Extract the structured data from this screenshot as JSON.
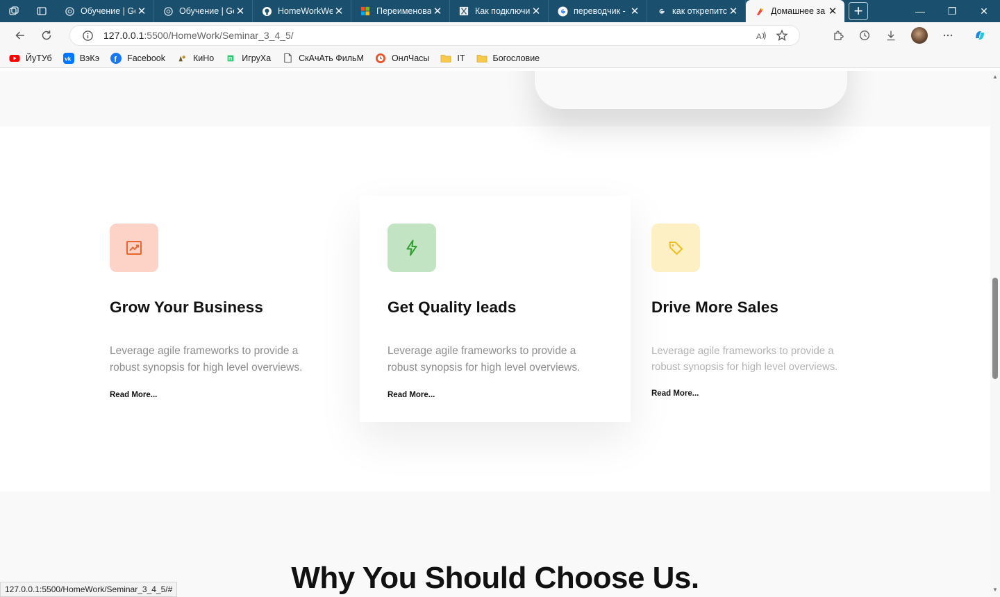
{
  "browser": {
    "tabs": [
      {
        "title": "Обучение | Ge",
        "favicon": "gear-favicon"
      },
      {
        "title": "Обучение | Ge",
        "favicon": "gear-favicon"
      },
      {
        "title": "HomeWorkWe",
        "favicon": "github-favicon"
      },
      {
        "title": "Переименова",
        "favicon": "microsoft-favicon"
      },
      {
        "title": "Как подключи",
        "favicon": "x-favicon"
      },
      {
        "title": "переводчик -",
        "favicon": "google-favicon"
      },
      {
        "title": "как открепитс",
        "favicon": "google-gray-favicon"
      },
      {
        "title": "Домашнее за",
        "favicon": "liveserver-favicon"
      }
    ],
    "address": {
      "host": "127.0.0.1",
      "path": ":5500/HomeWork/Seminar_3_4_5/"
    },
    "favorites": [
      {
        "label": "ЙуТУб",
        "icon": "youtube-icon"
      },
      {
        "label": "ВэКэ",
        "icon": "vk-icon"
      },
      {
        "label": "Facebook",
        "icon": "facebook-icon"
      },
      {
        "label": "КиНо",
        "icon": "kino-icon"
      },
      {
        "label": "ИгруХа",
        "icon": "game-icon"
      },
      {
        "label": "СкАчАть ФильМ",
        "icon": "page-icon"
      },
      {
        "label": "ОнлЧасы",
        "icon": "clock-icon"
      },
      {
        "label": "IT",
        "icon": "folder-icon"
      },
      {
        "label": "Богословие",
        "icon": "folder-icon"
      }
    ],
    "status_url": "127.0.0.1:5500/HomeWork/Seminar_3_4_5/#"
  },
  "page": {
    "cards": [
      {
        "title": "Grow Your Business",
        "text": "Leverage agile frameworks to provide a robust synopsis for high level overviews.",
        "link": "Read More...",
        "icon": "chart-up-icon",
        "icon_bg": "#fcd3c6",
        "icon_color": "#e8652f"
      },
      {
        "title": "Get Quality leads",
        "text": "Leverage agile frameworks to provide a robust synopsis for high level overviews.",
        "link": "Read More...",
        "icon": "lightning-icon",
        "icon_bg": "#c3e4c2",
        "icon_color": "#2e9d2e"
      },
      {
        "title": "Drive More Sales",
        "text": "Leverage agile frameworks to provide a robust synopsis for high level overviews.",
        "link": "Read More...",
        "icon": "tag-icon",
        "icon_bg": "#fdf0c4",
        "icon_color": "#f2bd1e"
      }
    ],
    "section_heading": "Why You Should Choose Us."
  }
}
